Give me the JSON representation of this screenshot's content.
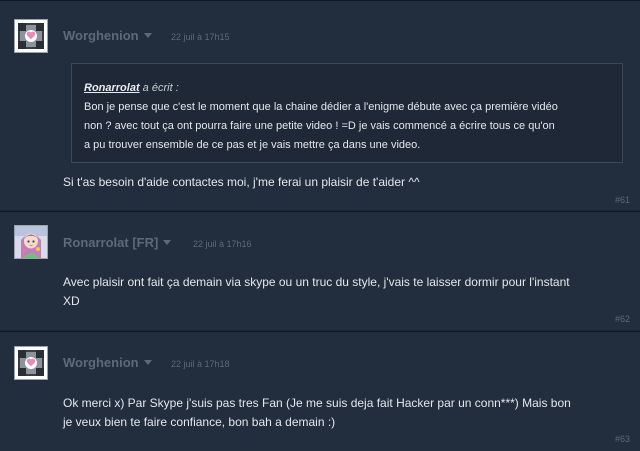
{
  "posts": [
    {
      "author": "Worghenion",
      "avatar_icon": "companion-cube-icon",
      "date": "22 juil à 17h15",
      "quote": {
        "author": "Ronarrolat",
        "wrote": " a écrit :",
        "text": "Bon je pense que c'est le moment que la chaine dédier a l'enigme débute avec ça première vidéo\nnon ? avec tout ça ont pourra faire une petite video ! =D je vais commencé a écrire tous ce qu'on\na pu trouver ensemble de ce pas et je vais mettre ça dans une video."
      },
      "text": "Si t'as besoin d'aide contactes moi, j'me ferai un plaisir de t'aider ^^",
      "number": "#61"
    },
    {
      "author": "Ronarrolat [FR]",
      "avatar_icon": "anime-girl-avatar",
      "date": "22 juil à 17h16",
      "text": "Avec plaisir ont fait ça demain via skype ou un truc du style, j'vais te laisser dormir pour l'instant\nXD",
      "number": "#62"
    },
    {
      "author": "Worghenion",
      "avatar_icon": "companion-cube-icon",
      "date": "22 juil à 17h18",
      "text": "Ok merci x) Par Skype j'suis pas tres Fan (Je me suis deja fait Hacker par un conn***) Mais bon\nje veux bien te faire confiance, bon bah a demain :)",
      "number": "#63"
    }
  ],
  "colors": {
    "page_bg": "#1b2636",
    "post_bg": "#222d3d",
    "muted": "#5d6a78",
    "text": "#e4e8ec",
    "quote_border": "#3c4858"
  }
}
